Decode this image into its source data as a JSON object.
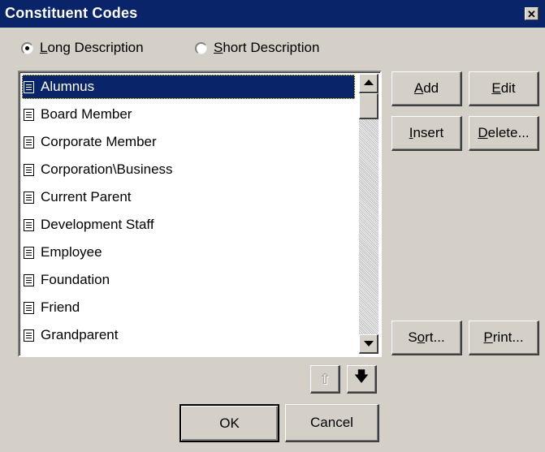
{
  "window": {
    "title": "Constituent Codes",
    "close_glyph": "✕"
  },
  "radio": {
    "long": {
      "pre": "",
      "key": "L",
      "post": "ong Description",
      "checked": true
    },
    "short": {
      "pre": "",
      "key": "S",
      "post": "hort Description",
      "checked": false
    }
  },
  "list": {
    "items": [
      "Alumnus",
      "Board Member",
      "Corporate Member",
      "Corporation\\Business",
      "Current Parent",
      "Development Staff",
      "Employee",
      "Foundation",
      "Friend",
      "Grandparent"
    ],
    "selected_index": 0
  },
  "buttons": {
    "add": {
      "pre": "",
      "key": "A",
      "post": "dd"
    },
    "edit": {
      "pre": "",
      "key": "E",
      "post": "dit"
    },
    "insert": {
      "pre": "",
      "key": "I",
      "post": "nsert"
    },
    "delete": {
      "pre": "",
      "key": "D",
      "post": "elete..."
    },
    "sort": {
      "pre": "S",
      "key": "o",
      "post": "rt..."
    },
    "print": {
      "pre": "",
      "key": "P",
      "post": "rint..."
    },
    "move_up": "⇧",
    "move_down": "🡇",
    "ok": "OK",
    "cancel": "Cancel"
  },
  "icons": {
    "list_item": "document-icon",
    "scroll_up": "triangle-up-icon",
    "scroll_down": "triangle-down-icon",
    "move_up": "arrow-up-icon",
    "move_down": "arrow-down-icon"
  },
  "colors": {
    "titlebar": "#0a246a",
    "face": "#d4d0c8",
    "selection": "#0a246a"
  }
}
